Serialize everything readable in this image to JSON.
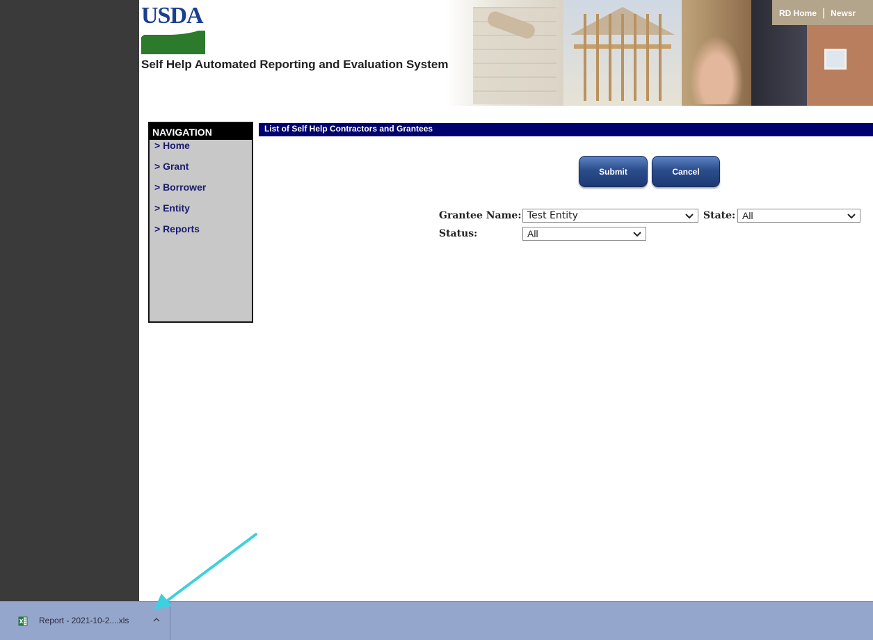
{
  "header": {
    "logo_text": "USDA",
    "site_title": "Self Help Automated Reporting and Evaluation System",
    "top_links": [
      "RD Home",
      "|",
      "Newsr"
    ]
  },
  "navigation": {
    "title": "NAVIGATION",
    "items": [
      "> Home",
      "> Grant",
      "> Borrower",
      "> Entity",
      "> Reports"
    ]
  },
  "main": {
    "heading": "List of Self Help Contractors and Grantees",
    "buttons": {
      "submit": "Submit",
      "cancel": "Cancel"
    },
    "filters": {
      "grantee_label": "Grantee Name:",
      "grantee_value": "Test Entity",
      "state_label": "State:",
      "state_value": "All",
      "status_label": "Status:",
      "status_value": "All"
    }
  },
  "download_bar": {
    "file_name": "Report - 2021-10-2....xls",
    "file_icon": "excel-file-icon",
    "menu_icon": "chevron-up-icon",
    "annotation": "cyan-arrow-pointing-to-download"
  },
  "colors": {
    "heading_bar": "#00006e",
    "nav_background": "#c8c8c8",
    "button_blue": "#2c4d8c",
    "download_bar": "#94a6cc",
    "annotation_arrow": "#3fd0e0"
  }
}
